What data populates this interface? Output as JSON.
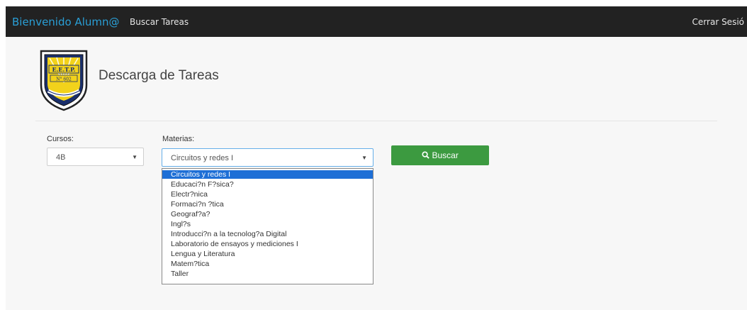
{
  "navbar": {
    "brand": "Bienvenido Alumn@",
    "link": "Buscar Tareas",
    "logout": "Cerrar Sesió"
  },
  "logo": {
    "line1": "E.E.T.P.",
    "line2": "N° 602"
  },
  "page": {
    "title": "Descarga de Tareas"
  },
  "form": {
    "cursos_label": "Cursos:",
    "cursos_value": "4B",
    "materias_label": "Materias:",
    "materias_value": "Circuitos y redes I",
    "search_label": "Buscar"
  },
  "materias_options": [
    "Circuitos y redes I",
    "Educaci?n F?sica?",
    "Electr?nica",
    "Formaci?n ?tica",
    "Geograf?a?",
    "Ingl?s",
    "Introducci?n a la tecnolog?a Digital",
    "Laboratorio de ensayos y mediciones I",
    "Lengua y Literatura",
    "Matem?tica",
    "Taller"
  ],
  "colors": {
    "navbar": "#222222",
    "brand": "#2a9fd6",
    "button": "#3c9a40",
    "option_selected": "#1e6fd6"
  }
}
